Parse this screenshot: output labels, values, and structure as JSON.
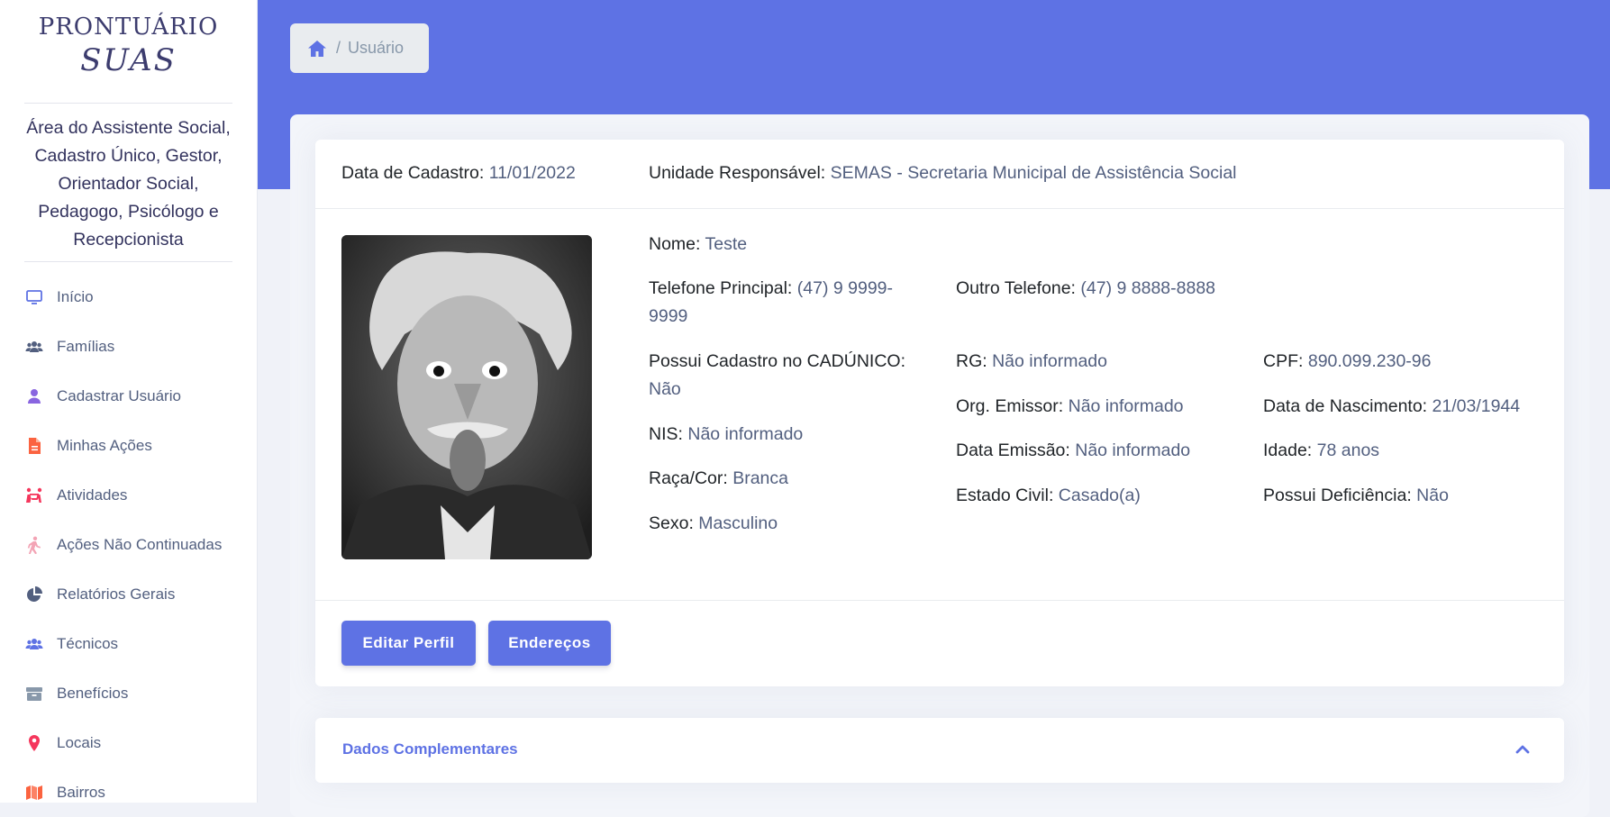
{
  "brand": {
    "line1": "PRONTUÁRIO",
    "line2": "SUAS"
  },
  "roles": "Área do Assistente Social, Cadastro Único, Gestor, Orientador Social, Pedagogo, Psicólogo e Recepcionista",
  "sidebar": {
    "items": [
      {
        "label": "Início",
        "icon": "monitor-icon",
        "color": "#5e72e4"
      },
      {
        "label": "Famílias",
        "icon": "users-icon",
        "color": "#525f7f"
      },
      {
        "label": "Cadastrar Usuário",
        "icon": "user-icon",
        "color": "#8965e0"
      },
      {
        "label": "Minhas Ações",
        "icon": "file-icon",
        "color": "#fb6340"
      },
      {
        "label": "Atividades",
        "icon": "people-activity-icon",
        "color": "#f5365c"
      },
      {
        "label": "Ações Não Continuadas",
        "icon": "walking-icon",
        "color": "#f3a4b5"
      },
      {
        "label": "Relatórios Gerais",
        "icon": "pie-chart-icon",
        "color": "#525f7f"
      },
      {
        "label": "Técnicos",
        "icon": "users-icon",
        "color": "#5e72e4"
      },
      {
        "label": "Benefícios",
        "icon": "archive-icon",
        "color": "#8898aa"
      },
      {
        "label": "Locais",
        "icon": "map-pin-icon",
        "color": "#f5365c"
      },
      {
        "label": "Bairros",
        "icon": "map-icon",
        "color": "#fb6340"
      }
    ]
  },
  "breadcrumb": {
    "current": "Usuário",
    "separator": "/"
  },
  "header": {
    "date_label": "Data de Cadastro:",
    "date_value": "11/01/2022",
    "unit_label": "Unidade Responsável:",
    "unit_value": "SEMAS - Secretaria Municipal de Assistência Social"
  },
  "user": {
    "nome": {
      "label": "Nome:",
      "value": "Teste"
    },
    "telefone": {
      "label": "Telefone Principal:",
      "value": "(47) 9 9999-9999"
    },
    "outro_telefone": {
      "label": "Outro Telefone:",
      "value": "(47) 9 8888-8888"
    },
    "cadunico": {
      "label": "Possui Cadastro no CADÚNICO:",
      "value": "Não"
    },
    "nis": {
      "label": "NIS:",
      "value": "Não informado"
    },
    "raca": {
      "label": "Raça/Cor:",
      "value": "Branca"
    },
    "sexo": {
      "label": "Sexo:",
      "value": "Masculino"
    },
    "rg": {
      "label": "RG:",
      "value": "Não informado"
    },
    "org_emissor": {
      "label": "Org. Emissor:",
      "value": "Não informado"
    },
    "data_emissao": {
      "label": "Data Emissão:",
      "value": "Não informado"
    },
    "estado_civil": {
      "label": "Estado Civil:",
      "value": "Casado(a)"
    },
    "cpf": {
      "label": "CPF:",
      "value": "890.099.230-96"
    },
    "nascimento": {
      "label": "Data de Nascimento:",
      "value": "21/03/1944"
    },
    "idade": {
      "label": "Idade:",
      "value": "78 anos"
    },
    "deficiencia": {
      "label": "Possui Deficiência:",
      "value": "Não"
    }
  },
  "buttons": {
    "edit": "Editar Perfil",
    "addresses": "Endereços"
  },
  "complementary": {
    "title": "Dados Complementares"
  },
  "colors": {
    "primary": "#5e72e4",
    "text": "#525f7f",
    "heading": "#212529"
  }
}
